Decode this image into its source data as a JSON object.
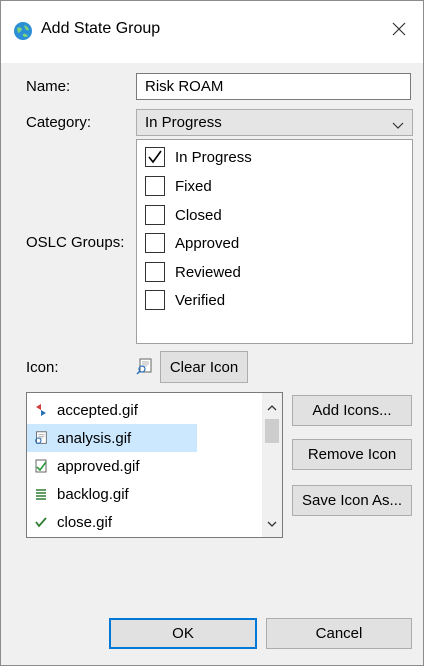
{
  "window": {
    "title": "Add State Group",
    "close_glyph": "✕"
  },
  "form": {
    "name_label": "Name:",
    "name_value": "Risk ROAM",
    "category_label": "Category:",
    "category_value": "In Progress",
    "oslc_label": "OSLC Groups:",
    "oslc_groups": [
      {
        "label": "In Progress",
        "checked": true
      },
      {
        "label": "Fixed",
        "checked": false
      },
      {
        "label": "Closed",
        "checked": false
      },
      {
        "label": "Approved",
        "checked": false
      },
      {
        "label": "Reviewed",
        "checked": false
      },
      {
        "label": "Verified",
        "checked": false
      }
    ],
    "icon_label": "Icon:",
    "current_icon": "analysis-icon",
    "clear_icon_label": "Clear Icon"
  },
  "icon_list": {
    "items": [
      {
        "name": "accepted.gif",
        "icon": "accepted-icon",
        "selected": false
      },
      {
        "name": "analysis.gif",
        "icon": "analysis-icon",
        "selected": true
      },
      {
        "name": "approved.gif",
        "icon": "approved-icon",
        "selected": false
      },
      {
        "name": "backlog.gif",
        "icon": "backlog-icon",
        "selected": false
      },
      {
        "name": "close.gif",
        "icon": "checkmark-icon",
        "selected": false
      }
    ],
    "add_icons_label": "Add Icons...",
    "remove_icon_label": "Remove Icon",
    "save_icon_as_label": "Save Icon As..."
  },
  "footer": {
    "ok_label": "OK",
    "cancel_label": "Cancel"
  },
  "colors": {
    "selection": "#cce8ff",
    "default_button_border": "#0078d7",
    "dialog_bg": "#f0f0f0"
  }
}
